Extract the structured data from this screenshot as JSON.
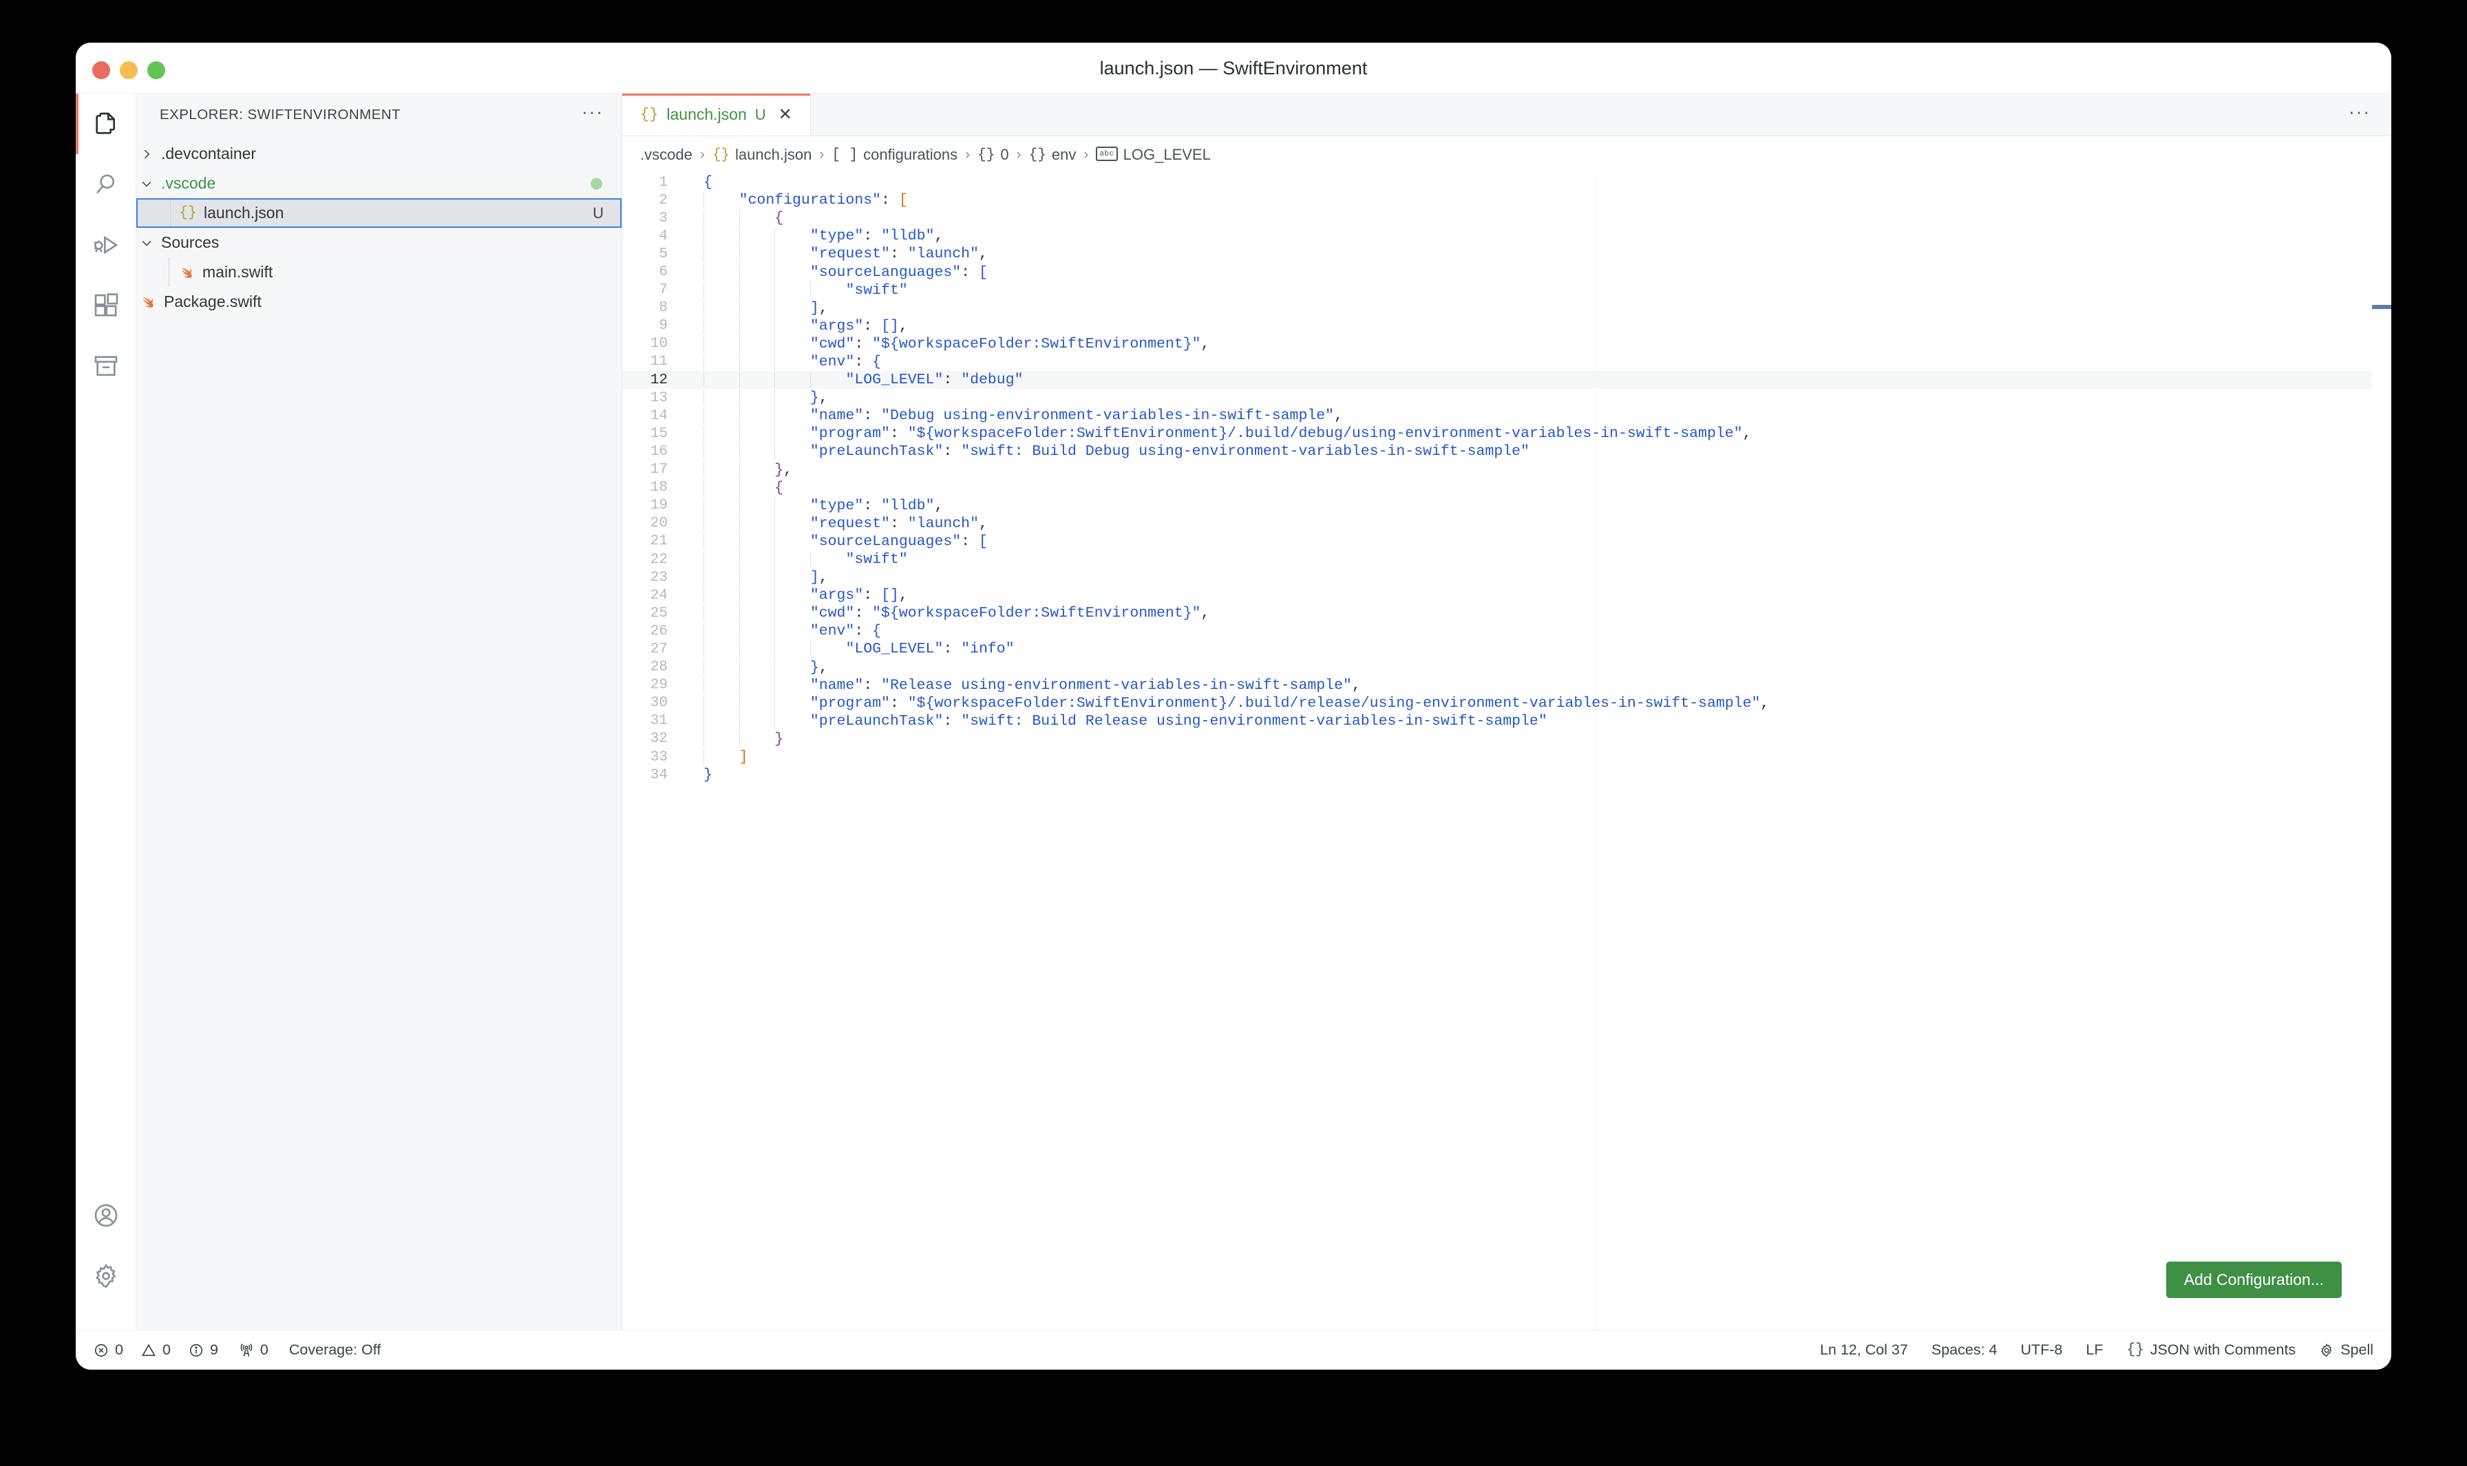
{
  "window": {
    "title": "launch.json — SwiftEnvironment",
    "traffic_lights": [
      "close",
      "minimize",
      "maximize"
    ]
  },
  "activitybar": {
    "items": [
      {
        "name": "explorer",
        "icon": "files-icon",
        "active": true
      },
      {
        "name": "search",
        "icon": "search-icon",
        "active": false
      },
      {
        "name": "run-and-debug",
        "icon": "debug-alt-icon",
        "active": false
      },
      {
        "name": "extensions",
        "icon": "extensions-icon",
        "active": false
      },
      {
        "name": "source-control-archive",
        "icon": "archive-icon",
        "active": false
      }
    ],
    "bottom_items": [
      {
        "name": "accounts",
        "icon": "account-icon"
      },
      {
        "name": "manage-settings",
        "icon": "gear-icon"
      }
    ]
  },
  "sidebar": {
    "title": "EXPLORER: SWIFTENVIRONMENT",
    "more_actions": "···",
    "tree": [
      {
        "label": ".devcontainer",
        "twisty": "›",
        "icon": "",
        "indent": 0,
        "kind": "folder",
        "selected": false,
        "badge": ""
      },
      {
        "label": ".vscode",
        "twisty": "⌄",
        "icon": "",
        "indent": 0,
        "kind": "folder",
        "selected": false,
        "badge": "dot",
        "label_color": "green"
      },
      {
        "label": "launch.json",
        "twisty": "",
        "icon": "{}",
        "indent": 1,
        "kind": "file-json",
        "selected": true,
        "badge": "U"
      },
      {
        "label": "Sources",
        "twisty": "⌄",
        "icon": "",
        "indent": 0,
        "kind": "folder",
        "selected": false,
        "badge": ""
      },
      {
        "label": "main.swift",
        "twisty": "",
        "icon": "swift",
        "indent": 1,
        "kind": "file-swift",
        "selected": false,
        "badge": ""
      },
      {
        "label": "Package.swift",
        "twisty": "",
        "icon": "swift",
        "indent": 0,
        "kind": "file-swift",
        "selected": false,
        "badge": ""
      }
    ]
  },
  "editor": {
    "tab": {
      "icon": "{}",
      "label": "launch.json",
      "dirty_badge": "U",
      "close": "✕"
    },
    "tabbar_actions": "···",
    "breadcrumb": [
      {
        "icon": "",
        "label": ".vscode"
      },
      {
        "icon": "{}",
        "icon_kind": "json",
        "label": "launch.json"
      },
      {
        "icon": "[ ]",
        "icon_kind": "arr",
        "label": "configurations"
      },
      {
        "icon": "{}",
        "icon_kind": "obj",
        "label": "0"
      },
      {
        "icon": "{}",
        "icon_kind": "obj",
        "label": "env"
      },
      {
        "icon": "abc",
        "icon_kind": "abc",
        "label": "LOG_LEVEL"
      }
    ],
    "breadcrumb_separator": "›",
    "add_configuration_label": "Add Configuration...",
    "active_line": 12,
    "lines": [
      {
        "n": 1,
        "guides": 0,
        "html": "<span class=\"b0\">{</span>"
      },
      {
        "n": 2,
        "guides": 1,
        "html": "    <span class=\"k\">\"configurations\"</span><span class=\"p\">:</span> <span class=\"b1\">[</span>"
      },
      {
        "n": 3,
        "guides": 2,
        "html": "        <span class=\"b2\">{</span>"
      },
      {
        "n": 4,
        "guides": 3,
        "html": "            <span class=\"k\">\"type\"</span><span class=\"p\">:</span> <span class=\"s\">\"lldb\"</span><span class=\"p\">,</span>"
      },
      {
        "n": 5,
        "guides": 3,
        "html": "            <span class=\"k\">\"request\"</span><span class=\"p\">:</span> <span class=\"s\">\"launch\"</span><span class=\"p\">,</span>"
      },
      {
        "n": 6,
        "guides": 3,
        "html": "            <span class=\"k\">\"sourceLanguages\"</span><span class=\"p\">:</span> <span class=\"b3\">[</span>"
      },
      {
        "n": 7,
        "guides": 4,
        "html": "                <span class=\"s\">\"swift\"</span>"
      },
      {
        "n": 8,
        "guides": 3,
        "html": "            <span class=\"b3\">]</span><span class=\"p\">,</span>"
      },
      {
        "n": 9,
        "guides": 3,
        "html": "            <span class=\"k\">\"args\"</span><span class=\"p\">:</span> <span class=\"b3\">[]</span><span class=\"p\">,</span>"
      },
      {
        "n": 10,
        "guides": 3,
        "html": "            <span class=\"k\">\"cwd\"</span><span class=\"p\">:</span> <span class=\"s\">\"${workspaceFolder:SwiftEnvironment}\"</span><span class=\"p\">,</span>"
      },
      {
        "n": 11,
        "guides": 3,
        "html": "            <span class=\"k\">\"env\"</span><span class=\"p\">:</span> <span class=\"b3\">{</span>"
      },
      {
        "n": 12,
        "guides": 4,
        "html": "                <span class=\"k\">\"LOG_LEVEL\"</span><span class=\"p\">:</span> <span class=\"s\">\"debug\"</span>"
      },
      {
        "n": 13,
        "guides": 3,
        "html": "            <span class=\"b3\">}</span><span class=\"p\">,</span>"
      },
      {
        "n": 14,
        "guides": 3,
        "html": "            <span class=\"k\">\"name\"</span><span class=\"p\">:</span> <span class=\"s\">\"Debug using-environment-variables-in-swift-sample\"</span><span class=\"p\">,</span>"
      },
      {
        "n": 15,
        "guides": 3,
        "html": "            <span class=\"k\">\"program\"</span><span class=\"p\">:</span> <span class=\"s\">\"${workspaceFolder:SwiftEnvironment}/.build/debug/using-environment-variables-in-swift-sample\"</span><span class=\"p\">,</span>"
      },
      {
        "n": 16,
        "guides": 3,
        "html": "            <span class=\"k\">\"preLaunchTask\"</span><span class=\"p\">:</span> <span class=\"s\">\"swift: Build Debug using-environment-variables-in-swift-sample\"</span>"
      },
      {
        "n": 17,
        "guides": 2,
        "html": "        <span class=\"b2\">}</span><span class=\"p\">,</span>"
      },
      {
        "n": 18,
        "guides": 2,
        "html": "        <span class=\"b2\">{</span>"
      },
      {
        "n": 19,
        "guides": 3,
        "html": "            <span class=\"k\">\"type\"</span><span class=\"p\">:</span> <span class=\"s\">\"lldb\"</span><span class=\"p\">,</span>"
      },
      {
        "n": 20,
        "guides": 3,
        "html": "            <span class=\"k\">\"request\"</span><span class=\"p\">:</span> <span class=\"s\">\"launch\"</span><span class=\"p\">,</span>"
      },
      {
        "n": 21,
        "guides": 3,
        "html": "            <span class=\"k\">\"sourceLanguages\"</span><span class=\"p\">:</span> <span class=\"b3\">[</span>"
      },
      {
        "n": 22,
        "guides": 4,
        "html": "                <span class=\"s\">\"swift\"</span>"
      },
      {
        "n": 23,
        "guides": 3,
        "html": "            <span class=\"b3\">]</span><span class=\"p\">,</span>"
      },
      {
        "n": 24,
        "guides": 3,
        "html": "            <span class=\"k\">\"args\"</span><span class=\"p\">:</span> <span class=\"b3\">[]</span><span class=\"p\">,</span>"
      },
      {
        "n": 25,
        "guides": 3,
        "html": "            <span class=\"k\">\"cwd\"</span><span class=\"p\">:</span> <span class=\"s\">\"${workspaceFolder:SwiftEnvironment}\"</span><span class=\"p\">,</span>"
      },
      {
        "n": 26,
        "guides": 3,
        "html": "            <span class=\"k\">\"env\"</span><span class=\"p\">:</span> <span class=\"b3\">{</span>"
      },
      {
        "n": 27,
        "guides": 4,
        "html": "                <span class=\"k\">\"LOG_LEVEL\"</span><span class=\"p\">:</span> <span class=\"s\">\"info\"</span>"
      },
      {
        "n": 28,
        "guides": 3,
        "html": "            <span class=\"b3\">}</span><span class=\"p\">,</span>"
      },
      {
        "n": 29,
        "guides": 3,
        "html": "            <span class=\"k\">\"name\"</span><span class=\"p\">:</span> <span class=\"s\">\"Release using-environment-variables-in-swift-sample\"</span><span class=\"p\">,</span>"
      },
      {
        "n": 30,
        "guides": 3,
        "html": "            <span class=\"k\">\"program\"</span><span class=\"p\">:</span> <span class=\"s\">\"${workspaceFolder:SwiftEnvironment}/.build/release/using-environment-variables-in-swift-sample\"</span><span class=\"p\">,</span>"
      },
      {
        "n": 31,
        "guides": 3,
        "html": "            <span class=\"k\">\"preLaunchTask\"</span><span class=\"p\">:</span> <span class=\"s\">\"swift: Build Release using-environment-variables-in-swift-sample\"</span>"
      },
      {
        "n": 32,
        "guides": 2,
        "html": "        <span class=\"b2\">}</span>"
      },
      {
        "n": 33,
        "guides": 1,
        "html": "    <span class=\"b1\">]</span>"
      },
      {
        "n": 34,
        "guides": 0,
        "html": "<span class=\"b0\">}</span>"
      }
    ]
  },
  "statusbar": {
    "left": [
      {
        "name": "errors",
        "icon": "error-icon",
        "value": "0"
      },
      {
        "name": "warnings",
        "icon": "warning-icon",
        "value": "0"
      },
      {
        "name": "infos",
        "icon": "info-icon",
        "value": "9"
      },
      {
        "name": "ports",
        "icon": "radio-tower-icon",
        "value": "0"
      },
      {
        "name": "coverage",
        "icon": "",
        "value": "Coverage: Off"
      }
    ],
    "right": [
      {
        "name": "cursor-position",
        "icon": "",
        "value": "Ln 12, Col 37"
      },
      {
        "name": "indentation",
        "icon": "",
        "value": "Spaces: 4"
      },
      {
        "name": "encoding",
        "icon": "",
        "value": "UTF-8"
      },
      {
        "name": "eol",
        "icon": "",
        "value": "LF"
      },
      {
        "name": "language-mode",
        "icon": "{}",
        "value": "JSON with Comments"
      },
      {
        "name": "spell-checker",
        "icon": "spell-icon",
        "value": "Spell"
      }
    ]
  },
  "colors": {
    "accent_green": "#3f8f44",
    "activity_indicator": "#ee7b6a",
    "selection_border": "#3a7ff0",
    "json_key": "#2557c7",
    "bracket_orange": "#d4711a",
    "bracket_purple": "#7b3fa8",
    "sidebar_bg": "#f6f7f8",
    "editor_bg": "#ffffff"
  }
}
